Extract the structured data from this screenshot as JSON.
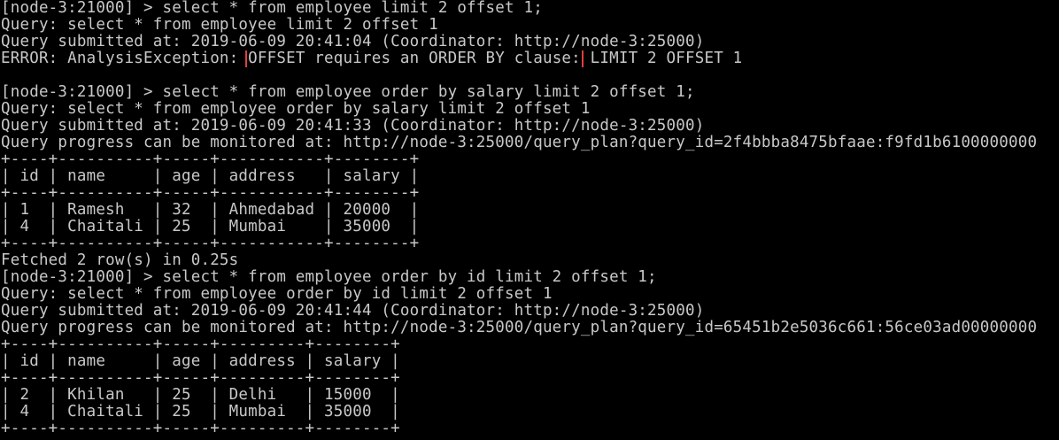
{
  "terminal": {
    "lines": [
      "[node-3:21000] > select * from employee limit 2 offset 1;",
      "Query: select * from employee limit 2 offset 1",
      "Query submitted at: 2019-06-09 20:41:04 (Coordinator: http://node-3:25000)",
      {
        "before": "ERROR: AnalysisException: ",
        "highlight": "OFFSET requires an ORDER BY clause:",
        "after": " LIMIT 2 OFFSET 1"
      },
      "",
      "[node-3:21000] > select * from employee order by salary limit 2 offset 1;",
      "Query: select * from employee order by salary limit 2 offset 1",
      "Query submitted at: 2019-06-09 20:41:33 (Coordinator: http://node-3:25000)",
      "Query progress can be monitored at: http://node-3:25000/query_plan?query_id=2f4bbba8475bfaae:f9fd1b6100000000",
      "+----+----------+-----+-----------+--------+",
      "| id | name     | age | address   | salary |",
      "+----+----------+-----+-----------+--------+",
      "| 1  | Ramesh   | 32  | Ahmedabad | 20000  |",
      "| 4  | Chaitali | 25  | Mumbai    | 35000  |",
      "+----+----------+-----+-----------+--------+",
      "Fetched 2 row(s) in 0.25s",
      "[node-3:21000] > select * from employee order by id limit 2 offset 1;",
      "Query: select * from employee order by id limit 2 offset 1",
      "Query submitted at: 2019-06-09 20:41:44 (Coordinator: http://node-3:25000)",
      "Query progress can be monitored at: http://node-3:25000/query_plan?query_id=65451b2e5036c661:56ce03ad00000000",
      "+----+----------+-----+---------+--------+",
      "| id | name     | age | address | salary |",
      "+----+----------+-----+---------+--------+",
      "| 2  | Khilan   | 25  | Delhi   | 15000  |",
      "| 4  | Chaitali | 25  | Mumbai  | 35000  |",
      "+----+----------+-----+---------+--------+"
    ]
  },
  "colors": {
    "background": "#000000",
    "text": "#c8c8c8",
    "highlight_border": "#e0403a"
  }
}
